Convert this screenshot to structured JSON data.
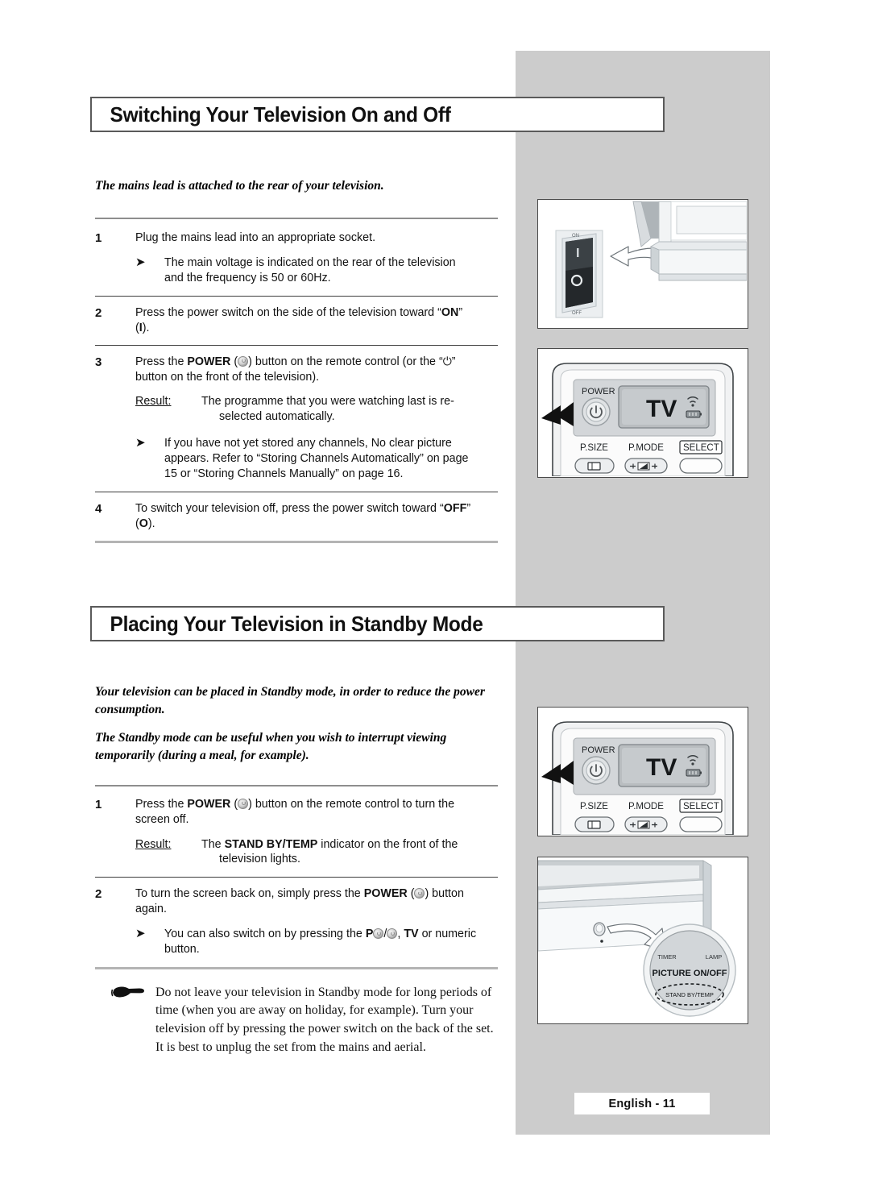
{
  "page": {
    "footer_label": "English - 11",
    "panel_color": "#cccccc"
  },
  "sections": [
    {
      "heading": "Switching Your Television On and Off",
      "lead": "The mains lead is attached to the rear of your television.",
      "steps": [
        {
          "num": "1",
          "text": "Plug the mains lead into an appropriate socket.",
          "bullet_1a": "The main voltage is indicated on the rear of the television",
          "bullet_1b": "and the frequency is 50 or 60Hz."
        },
        {
          "num": "2",
          "text_a": "Press the power switch on the side of the television toward “",
          "bold_on": "ON",
          "text_b": "”",
          "text_c": "(",
          "bold_i": "I",
          "text_d": ")."
        },
        {
          "num": "3",
          "text_a": "Press the ",
          "bold_power": "POWER",
          "text_b": " (",
          "text_c": ") button on the remote control (or the “",
          "standby_symbol": "⏻",
          "text_d": "”",
          "text_e": "button on the front of the television).",
          "result_label": "Result:",
          "result_a": "The programme that you were watching last is re-",
          "result_b": "selected automatically.",
          "bullet_a": "If you have not yet stored any channels, No clear picture",
          "bullet_b": "appears. Refer to “Storing Channels Automatically” on page",
          "bullet_c": "15 or “Storing Channels Manually” on page 16."
        },
        {
          "num": "4",
          "text_a": "To switch your television off, press the power switch toward “",
          "bold_off": "OFF",
          "text_b": "”",
          "text_c": "(",
          "bold_o": "O",
          "text_d": ")."
        }
      ]
    },
    {
      "heading": "Placing Your Television in Standby Mode",
      "lead_1": "Your television can be placed in Standby mode, in order to reduce the power consumption.",
      "lead_2": "The Standby mode can be useful when you wish to interrupt viewing temporarily (during a meal, for example).",
      "steps": [
        {
          "num": "1",
          "text_a": "Press the ",
          "bold_power": "POWER",
          "text_b": " (",
          "text_c": ") button on the remote control to turn the",
          "text_d": "screen off.",
          "result_label": "Result:",
          "result_a_1": "The ",
          "result_bold": "STAND BY/TEMP",
          "result_a_2": " indicator on the front of the",
          "result_b": "television lights."
        },
        {
          "num": "2",
          "text_a": "To turn the screen back on, simply press the ",
          "bold_power": "POWER",
          "text_b": " (",
          "text_c": ") button",
          "text_d": "again.",
          "bullet_a_1": "You can also switch on by pressing the ",
          "bullet_bold_p": "P",
          "bullet_a_2": "/",
          "bullet_a_3": ", ",
          "bullet_bold_tv": "TV",
          "bullet_a_4": " or numeric",
          "bullet_b": "button."
        }
      ],
      "note": "Do not leave your television in Standby mode for long periods of time (when you are away on holiday, for example). Turn your television off by pressing the power switch on the back of the set. It is best to unplug the set from the mains and aerial."
    }
  ],
  "illustrations": {
    "power_switch": {
      "label_on": "ON",
      "label_off": "OFF",
      "mark_i": "I",
      "mark_o": "O"
    },
    "remote": {
      "power_label": "POWER",
      "display_text": "TV",
      "psize_label": "P.SIZE",
      "pmode_label": "P.MODE",
      "select_label": "SELECT"
    },
    "front_panel": {
      "timer_label": "TIMER",
      "lamp_label": "LAMP",
      "picture_label": "PICTURE ON/OFF",
      "standby_label": "STAND BY/TEMP"
    }
  }
}
